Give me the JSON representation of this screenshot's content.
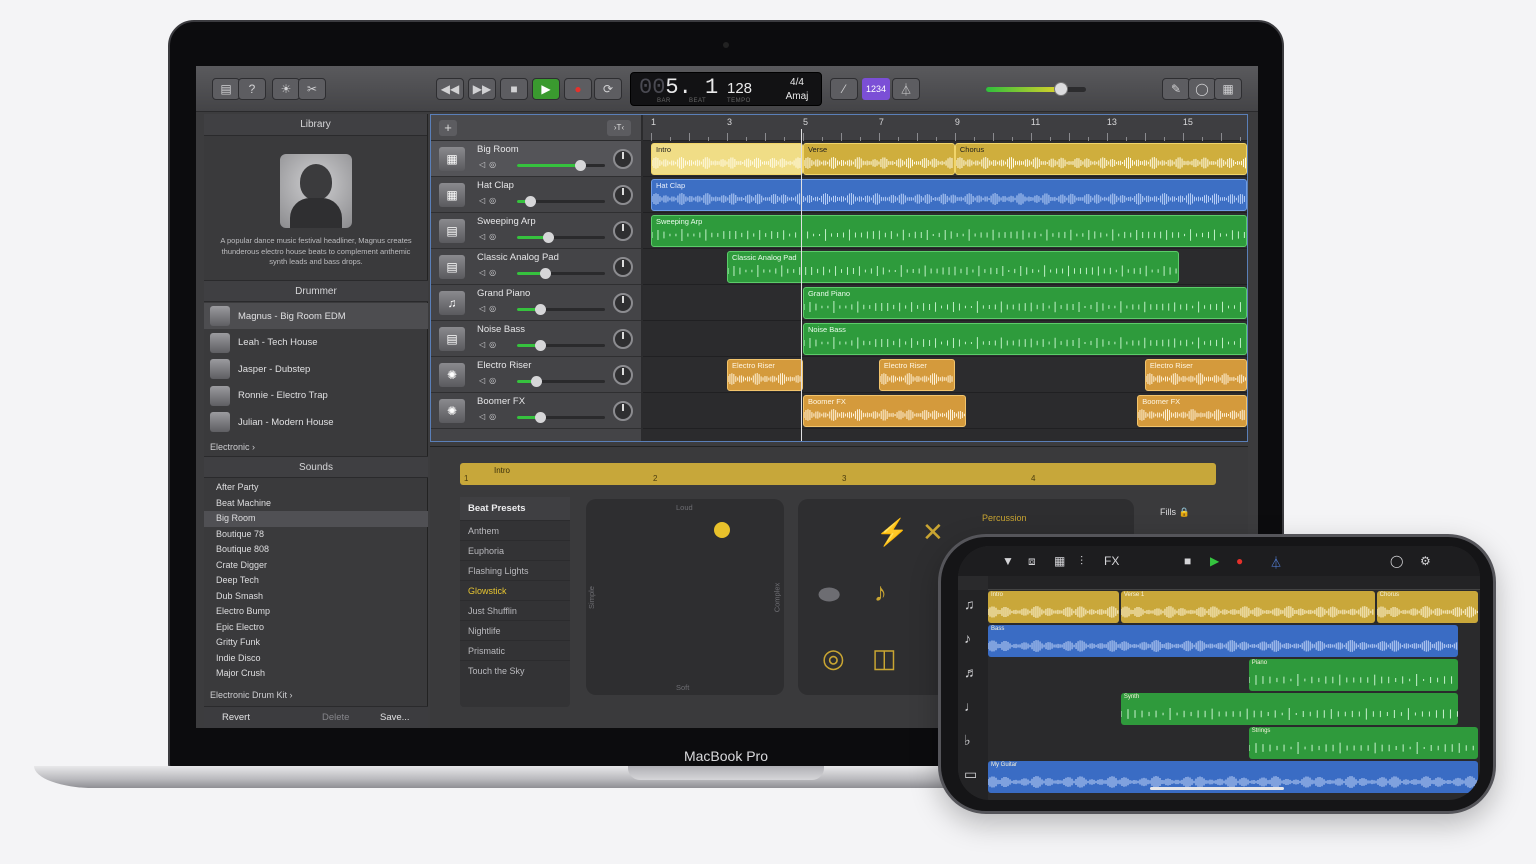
{
  "macbook": {
    "label": "MacBook Pro"
  },
  "toolbar": {
    "lcd_position_dim": "00",
    "lcd_position": "5. 1",
    "lcd_bar_label": "BAR",
    "lcd_beat_label": "BEAT",
    "lcd_tempo": "128",
    "lcd_tempo_label": "TEMPO",
    "lcd_time_signature": "4/4",
    "lcd_key": "Amaj",
    "count_in_label": "1234",
    "master_volume": 0.75
  },
  "library": {
    "title": "Library",
    "artist_signature": "Magnus",
    "description": "A popular dance music festival headliner, Magnus creates thunderous electro house beats to complement anthemic synth leads and bass drops.",
    "drummer_section": "Drummer",
    "drummers": [
      {
        "label": "Magnus - Big Room EDM",
        "selected": true
      },
      {
        "label": "Leah - Tech House",
        "selected": false
      },
      {
        "label": "Jasper - Dubstep",
        "selected": false
      },
      {
        "label": "Ronnie - Electro Trap",
        "selected": false
      },
      {
        "label": "Julian - Modern House",
        "selected": false
      }
    ],
    "genre_link": "Electronic ›",
    "sounds_section": "Sounds",
    "sounds": [
      {
        "label": "After Party",
        "selected": false
      },
      {
        "label": "Beat Machine",
        "selected": false
      },
      {
        "label": "Big Room",
        "selected": true
      },
      {
        "label": "Boutique 78",
        "selected": false
      },
      {
        "label": "Boutique 808",
        "selected": false
      },
      {
        "label": "Crate Digger",
        "selected": false
      },
      {
        "label": "Deep Tech",
        "selected": false
      },
      {
        "label": "Dub Smash",
        "selected": false
      },
      {
        "label": "Electro Bump",
        "selected": false
      },
      {
        "label": "Epic Electro",
        "selected": false
      },
      {
        "label": "Gritty Funk",
        "selected": false
      },
      {
        "label": "Indie Disco",
        "selected": false
      },
      {
        "label": "Major Crush",
        "selected": false
      }
    ],
    "kit_link": "Electronic Drum Kit ›",
    "footer": {
      "revert": "Revert",
      "delete": "Delete",
      "save": "Save..."
    }
  },
  "tracks": {
    "add_label": "+",
    "ruler_ticks": [
      "1",
      "3",
      "5",
      "7",
      "9",
      "11",
      "13",
      "15"
    ],
    "items": [
      {
        "name": "Big Room",
        "icon": "drum-machine-icon",
        "volume": 0.72,
        "selected": true
      },
      {
        "name": "Hat Clap",
        "icon": "drum-machine-icon",
        "volume": 0.15,
        "selected": false
      },
      {
        "name": "Sweeping Arp",
        "icon": "synth-keyboard-icon",
        "volume": 0.35,
        "selected": false
      },
      {
        "name": "Classic Analog Pad",
        "icon": "synth-keyboard-icon",
        "volume": 0.32,
        "selected": false
      },
      {
        "name": "Grand Piano",
        "icon": "grand-piano-icon",
        "volume": 0.26,
        "selected": false
      },
      {
        "name": "Noise Bass",
        "icon": "synth-keyboard-icon",
        "volume": 0.26,
        "selected": false
      },
      {
        "name": "Electro Riser",
        "icon": "sparkle-fx-icon",
        "volume": 0.22,
        "selected": false
      },
      {
        "name": "Boomer FX",
        "icon": "sparkle-fx-icon",
        "volume": 0.26,
        "selected": false
      }
    ],
    "regions": [
      {
        "lane": 0,
        "label": "Intro",
        "color": "yellow",
        "start": 1,
        "end": 5,
        "light": true
      },
      {
        "lane": 0,
        "label": "Verse",
        "color": "yellow",
        "start": 5,
        "end": 9
      },
      {
        "lane": 0,
        "label": "Chorus",
        "color": "yellow",
        "start": 9,
        "end": 16.7
      },
      {
        "lane": 1,
        "label": "Hat Clap",
        "color": "blue",
        "start": 1,
        "end": 16.7
      },
      {
        "lane": 2,
        "label": "Sweeping Arp",
        "color": "green",
        "start": 1,
        "end": 16.7
      },
      {
        "lane": 3,
        "label": "Classic Analog Pad",
        "color": "green",
        "start": 3,
        "end": 14.9
      },
      {
        "lane": 4,
        "label": "Grand Piano",
        "color": "green",
        "start": 5,
        "end": 16.7
      },
      {
        "lane": 5,
        "label": "Noise Bass",
        "color": "green",
        "start": 5,
        "end": 16.7
      },
      {
        "lane": 6,
        "label": "Electro Riser",
        "color": "orange",
        "start": 3,
        "end": 5
      },
      {
        "lane": 6,
        "label": "Electro Riser",
        "color": "orange",
        "start": 7,
        "end": 9
      },
      {
        "lane": 6,
        "label": "Electro Riser",
        "color": "orange",
        "start": 14,
        "end": 16.7
      },
      {
        "lane": 7,
        "label": "Boomer FX",
        "color": "orange",
        "start": 5,
        "end": 9.3
      },
      {
        "lane": 7,
        "label": "Boomer FX",
        "color": "orange",
        "start": 13.8,
        "end": 16.7
      }
    ]
  },
  "editor": {
    "region_label": "Intro",
    "ruler_numbers": [
      "1",
      "2",
      "3",
      "4"
    ],
    "presets_title": "Beat Presets",
    "presets": [
      {
        "label": "Anthem",
        "selected": false
      },
      {
        "label": "Euphoria",
        "selected": false
      },
      {
        "label": "Flashing Lights",
        "selected": false
      },
      {
        "label": "Glowstick",
        "selected": true
      },
      {
        "label": "Just Shufflin",
        "selected": false
      },
      {
        "label": "Nightlife",
        "selected": false
      },
      {
        "label": "Prismatic",
        "selected": false
      },
      {
        "label": "Touch the Sky",
        "selected": false
      }
    ],
    "xy_labels": {
      "top": "Loud",
      "bottom": "Soft",
      "left": "Simple",
      "right": "Complex"
    },
    "percussion_label": "Percussion",
    "fills_label": "Fills 🔒"
  },
  "iphone": {
    "fx_label": "FX",
    "regions": [
      {
        "lane": 0,
        "label": "Intro",
        "color": "yellow",
        "start": 0,
        "end": 0.27
      },
      {
        "lane": 0,
        "label": "Verse 1",
        "color": "yellow",
        "start": 0.27,
        "end": 0.79
      },
      {
        "lane": 0,
        "label": "Chorus",
        "color": "yellow",
        "start": 0.79,
        "end": 1.0
      },
      {
        "lane": 1,
        "label": "Bass",
        "color": "blue",
        "start": 0,
        "end": 0.96
      },
      {
        "lane": 2,
        "label": "Piano",
        "color": "green",
        "start": 0.53,
        "end": 0.96
      },
      {
        "lane": 3,
        "label": "Synth",
        "color": "green",
        "start": 0.27,
        "end": 0.96
      },
      {
        "lane": 4,
        "label": "Strings",
        "color": "green",
        "start": 0.53,
        "end": 1.0
      },
      {
        "lane": 5,
        "label": "My Guitar",
        "color": "blue",
        "start": 0,
        "end": 1.0
      }
    ]
  }
}
